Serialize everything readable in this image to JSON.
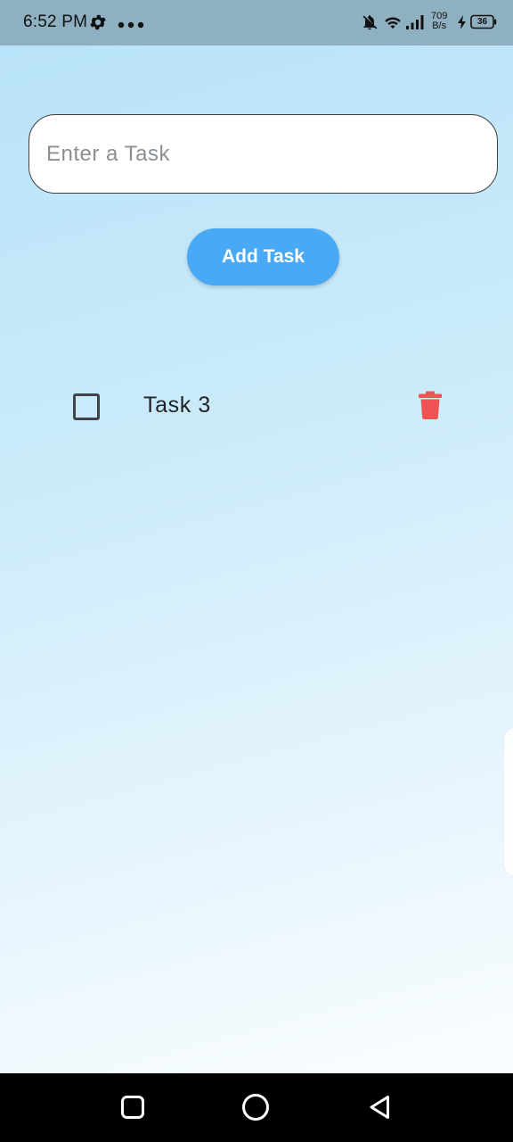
{
  "status_bar": {
    "time": "6:52 PM",
    "speed_value": "709",
    "speed_unit": "B/s",
    "battery": "36",
    "icons": [
      "gear-icon",
      "more-dots-icon",
      "notifications-off-icon",
      "wifi-icon",
      "signal-icon",
      "charging-icon",
      "battery-icon"
    ]
  },
  "task_input": {
    "placeholder": "Enter a Task",
    "value": ""
  },
  "add_button": {
    "label": "Add Task"
  },
  "tasks": [
    {
      "label": "Task 3",
      "checked": false
    }
  ],
  "colors": {
    "accent": "#4aa9f5",
    "delete": "#f05353"
  },
  "nav_bar": {
    "icons": [
      "recents-icon",
      "home-icon",
      "back-icon"
    ]
  }
}
